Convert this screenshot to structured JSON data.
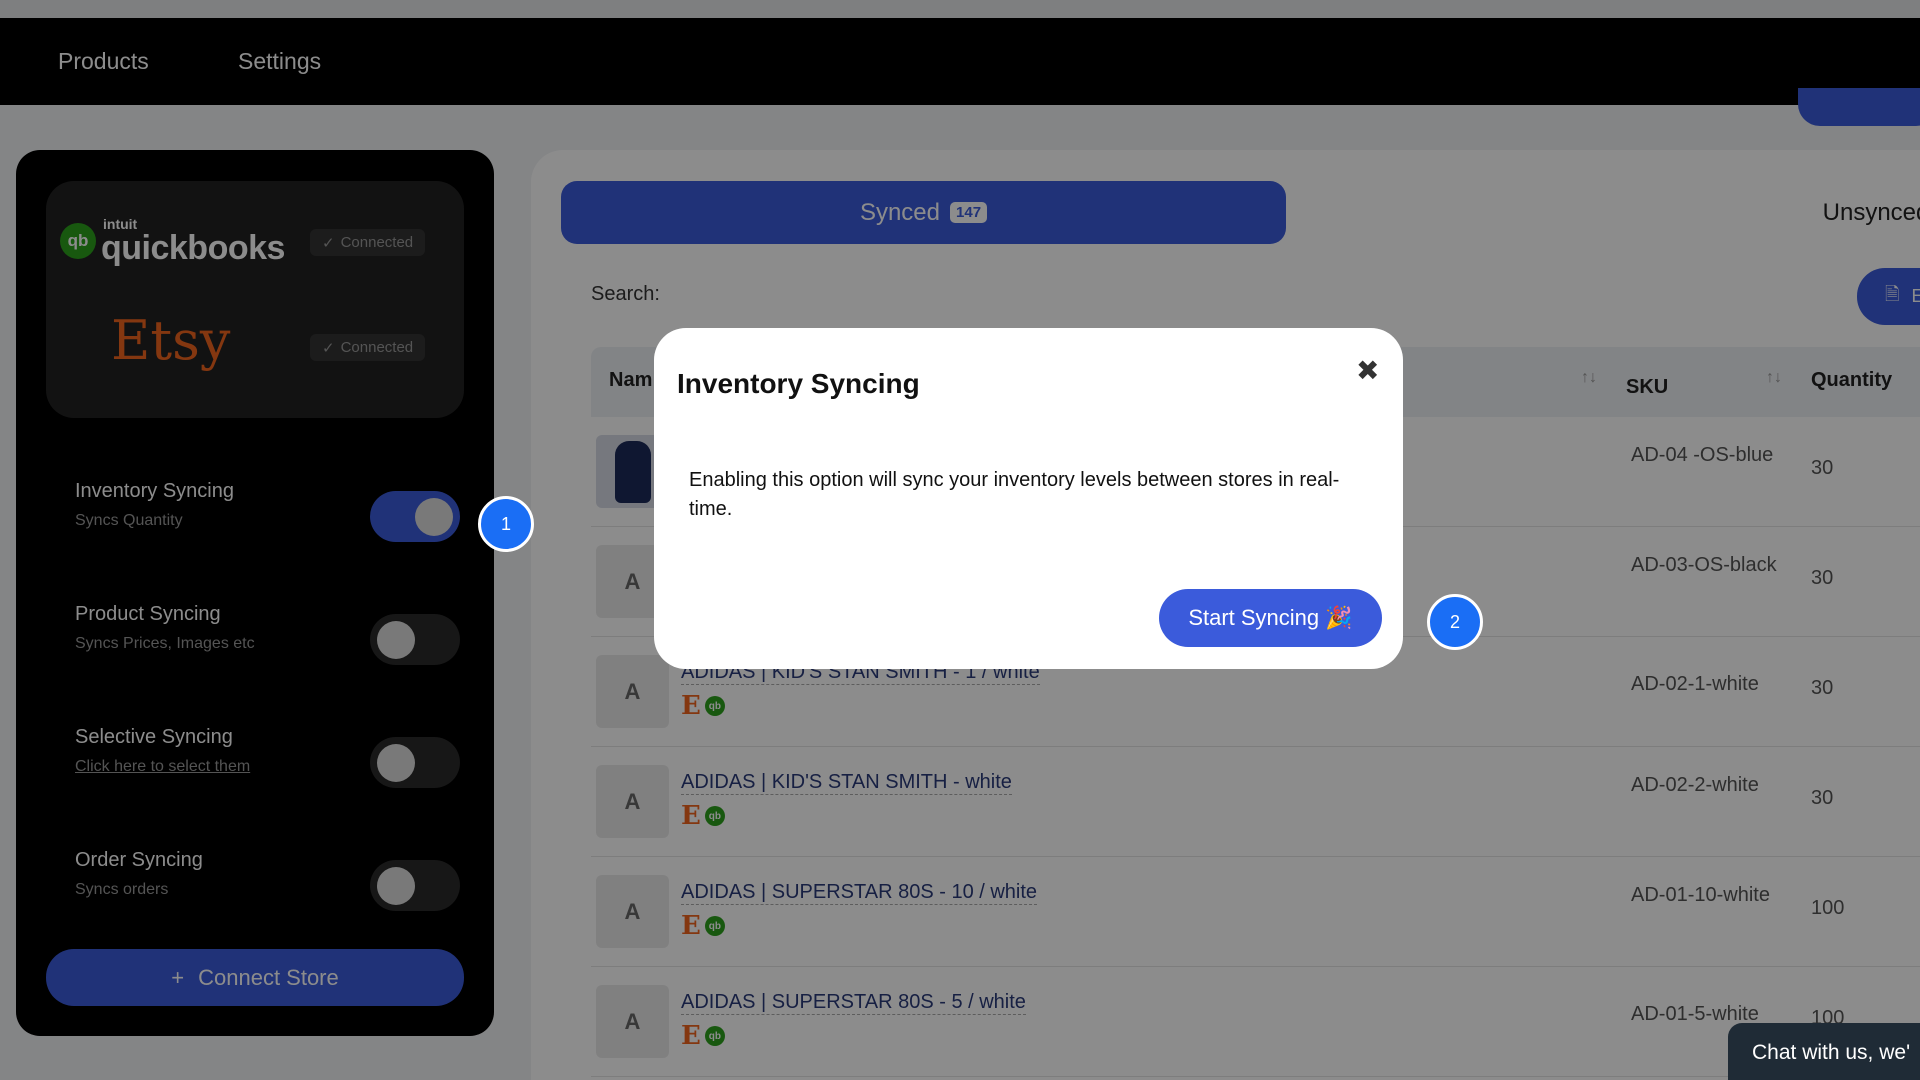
{
  "nav": {
    "items": [
      {
        "label": "Products"
      },
      {
        "label": "Settings"
      }
    ]
  },
  "sidebar": {
    "stores": [
      {
        "name": "quickbooks",
        "brand_top": "intuit",
        "status": "Connected",
        "color": "#2ca01c"
      },
      {
        "name": "Etsy",
        "status": "Connected",
        "color": "#f1641e"
      }
    ],
    "toggles": [
      {
        "title": "Inventory Syncing",
        "subtitle": "Syncs Quantity",
        "on": true
      },
      {
        "title": "Product Syncing",
        "subtitle": "Syncs Prices, Images etc",
        "on": false
      },
      {
        "title": "Selective Syncing",
        "subtitle": "Click here to select them",
        "on": false
      },
      {
        "title": "Order Syncing",
        "subtitle": "Syncs orders",
        "on": false
      }
    ],
    "connect_button": "Connect Store"
  },
  "main": {
    "tabs": [
      {
        "label": "Synced",
        "count": "147"
      },
      {
        "label": "Unsynced"
      }
    ],
    "search_label": "Search:",
    "export_label": "E",
    "table": {
      "headers": [
        "Nam",
        "SKU",
        "Quantity"
      ],
      "rows": [
        {
          "thumb": "",
          "name": "",
          "sku": "AD-04 -OS-blue",
          "qty": "30"
        },
        {
          "thumb": "A",
          "name": "",
          "sku": "AD-03-OS-black",
          "qty": "30"
        },
        {
          "thumb": "A",
          "name": "ADIDAS | KID'S STAN SMITH - 1 / white",
          "sku": "AD-02-1-white",
          "qty": "30"
        },
        {
          "thumb": "A",
          "name": "ADIDAS | KID'S STAN SMITH - white",
          "sku": "AD-02-2-white",
          "qty": "30"
        },
        {
          "thumb": "A",
          "name": "ADIDAS | SUPERSTAR 80S - 10 / white",
          "sku": "AD-01-10-white",
          "qty": "100"
        },
        {
          "thumb": "A",
          "name": "ADIDAS | SUPERSTAR 80S - 5 / white",
          "sku": "AD-01-5-white",
          "qty": "100"
        }
      ]
    }
  },
  "modal": {
    "title": "Inventory Syncing",
    "close": "✖",
    "body": "Enabling this option will sync your inventory levels between stores in real-time.",
    "button": "Start Syncing 🎉"
  },
  "steps": [
    "1",
    "2"
  ],
  "chat": {
    "label": "Chat with us, we'"
  },
  "colors": {
    "accent": "#3b5bdb",
    "quickbooks": "#2ca01c",
    "etsy": "#f1641e"
  }
}
